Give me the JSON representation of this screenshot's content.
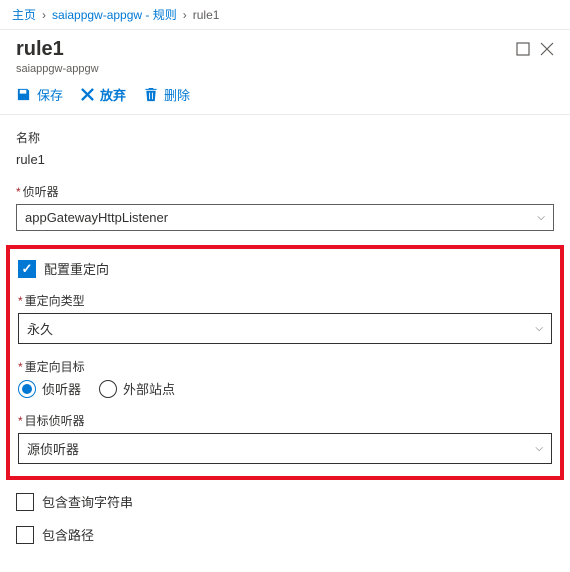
{
  "breadcrumb": {
    "home": "主页",
    "resource": "saiappgw-appgw - 规则",
    "current": "rule1"
  },
  "header": {
    "title": "rule1",
    "subtitle": "saiappgw-appgw"
  },
  "toolbar": {
    "save": "保存",
    "discard": "放弃",
    "delete": "删除"
  },
  "form": {
    "name_label": "名称",
    "name_value": "rule1",
    "listener_label": "侦听器",
    "listener_value": "appGatewayHttpListener",
    "configure_redirect_label": "配置重定向",
    "redirect_type_label": "重定向类型",
    "redirect_type_value": "永久",
    "redirect_target_label": "重定向目标",
    "radio_listener": "侦听器",
    "radio_external": "外部站点",
    "target_listener_label": "目标侦听器",
    "target_listener_value": "源侦听器",
    "include_query_label": "包含查询字符串",
    "include_path_label": "包含路径"
  }
}
